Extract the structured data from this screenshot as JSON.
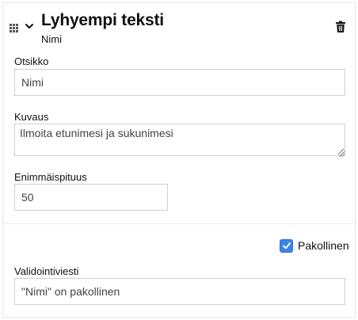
{
  "field": {
    "title": "Lyhyempi teksti",
    "subtitle": "Nimi"
  },
  "otsikko": {
    "label": "Otsikko",
    "value": "Nimi"
  },
  "kuvaus": {
    "label": "Kuvaus",
    "value": "Ilmoita etunimesi ja sukunimesi"
  },
  "enimmaispituus": {
    "label": "Enimmäispituus",
    "value": "50"
  },
  "pakollinen": {
    "label": "Pakollinen",
    "checked": true
  },
  "validointiviesti": {
    "label": "Validointiviesti",
    "value": "\"Nimi\" on pakollinen"
  },
  "icons": {
    "drag": "drag-handle-icon",
    "expand": "chevron-down-icon",
    "delete": "trash-icon"
  },
  "colors": {
    "checkbox": "#3b84e6"
  }
}
